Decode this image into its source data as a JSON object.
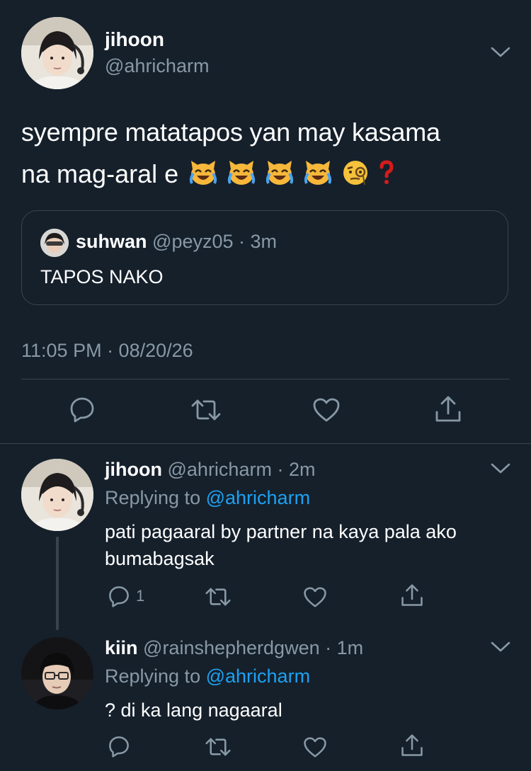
{
  "main_tweet": {
    "display_name": "jihoon",
    "handle": "@ahricharm",
    "text_line1": "syempre matatapos yan may kasama",
    "text_line2": "na mag-aral e",
    "emojis": [
      "cat-tears-emoji",
      "cat-tears-emoji",
      "cat-tears-emoji",
      "cat-tears-emoji",
      "monocle-face-emoji",
      "red-question-emoji"
    ],
    "quoted": {
      "display_name": "suhwan",
      "handle": "@peyz05",
      "time": "· 3m",
      "text": "TAPOS NAKO"
    },
    "timestamp": "11:05 PM · 08/20/26",
    "actions": [
      "reply-icon",
      "retweet-icon",
      "like-icon",
      "share-icon"
    ]
  },
  "replies": [
    {
      "display_name": "jihoon",
      "handle": "@ahricharm",
      "time": "· 2m",
      "replying_prefix": "Replying to",
      "replying_to": "@ahricharm",
      "text_line1": "pati pagaaral by partner na kaya pala ako",
      "text_line2": "bumabagsak",
      "reply_count": "1"
    },
    {
      "display_name": "kiin",
      "handle": "@rainshepherdgwen",
      "time": "· 1m",
      "replying_prefix": "Replying to",
      "replying_to": "@ahricharm",
      "text_line1": "? di ka lang nagaaral",
      "reply_count": ""
    }
  ],
  "colors": {
    "background": "#15202b",
    "muted": "#8899a6",
    "link": "#1da1f2",
    "divider": "#38444d"
  }
}
